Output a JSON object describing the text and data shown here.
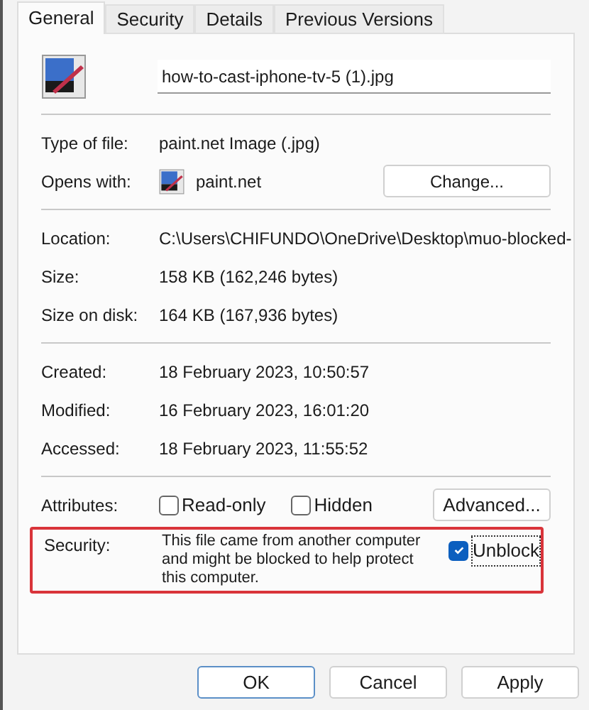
{
  "tabs": [
    {
      "label": "General",
      "selected": true
    },
    {
      "label": "Security",
      "selected": false
    },
    {
      "label": "Details",
      "selected": false
    },
    {
      "label": "Previous Versions",
      "selected": false
    }
  ],
  "file_name": "how-to-cast-iphone-tv-5 (1).jpg",
  "type_row": {
    "label": "Type of file:",
    "value": "paint.net Image (.jpg)"
  },
  "opens_with": {
    "label": "Opens with:",
    "value": "paint.net",
    "button": "Change..."
  },
  "location_rows": [
    {
      "label": "Location:",
      "value": "C:\\Users\\CHIFUNDO\\OneDrive\\Desktop\\muo-blocked-"
    },
    {
      "label": "Size:",
      "value": "158 KB (162,246 bytes)"
    },
    {
      "label": "Size on disk:",
      "value": "164 KB (167,936 bytes)"
    }
  ],
  "date_rows": [
    {
      "label": "Created:",
      "value": "18 February 2023, 10:50:57"
    },
    {
      "label": "Modified:",
      "value": "16 February 2023, 16:01:20"
    },
    {
      "label": "Accessed:",
      "value": "18 February 2023, 11:55:52"
    }
  ],
  "attributes": {
    "label": "Attributes:",
    "checkboxes": [
      {
        "label": "Read-only",
        "checked": false
      },
      {
        "label": "Hidden",
        "checked": false
      }
    ],
    "button": "Advanced..."
  },
  "security": {
    "label": "Security:",
    "text": "This file came from another computer and might be blocked to help protect this computer.",
    "unblock": {
      "label": "Unblock",
      "checked": true
    }
  },
  "buttons": [
    {
      "label": "OK",
      "selected": true
    },
    {
      "label": "Cancel",
      "selected": false
    },
    {
      "label": "Apply",
      "selected": false
    }
  ]
}
